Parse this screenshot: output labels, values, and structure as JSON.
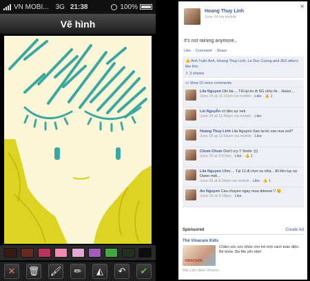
{
  "status": {
    "carrier": "VN MOBI...",
    "network": "3G",
    "time": "21:38",
    "battery": "100%"
  },
  "app": {
    "title": "Vẽ hình"
  },
  "palette": [
    "#3a1a10",
    "#6b2a1e",
    "#b8325a",
    "#f28db2",
    "#e5a6d8",
    "#a15db8",
    "#3fa93c",
    "#23301e",
    "#0d0d0d"
  ],
  "tools": [
    {
      "name": "close-tool",
      "glyph": "✕"
    },
    {
      "name": "trash-tool",
      "glyph": "🗑"
    },
    {
      "name": "brush-tool",
      "glyph": "🖌"
    },
    {
      "name": "pencil-tool",
      "glyph": "✏"
    },
    {
      "name": "eraser-tool",
      "glyph": "◭"
    },
    {
      "name": "undo-tool",
      "glyph": "↶"
    },
    {
      "name": "confirm-tool",
      "glyph": "✔"
    }
  ],
  "colors": {
    "teal": "#3aa8a0",
    "yellow": "#d9cf12",
    "canvas": "#fbf6d8",
    "fb_blue": "#3b5998"
  },
  "post": {
    "author": "Hoang Thuy Linh",
    "time": "June 24 via mobile",
    "text": "It's not raining anymore..",
    "actions": [
      "Like",
      "Comment",
      "Share"
    ],
    "likes": "Anh Tuấn Anh, Hoang Thuy Linh, Le Duc Cuong and 352 others like this.",
    "shares": "3 shares",
    "more_comments": "View 10 more comments"
  },
  "comments": [
    {
      "name": "Lila Nguyen",
      "text": "Oki bà.... Tối lại ko đi SG nữa rồi... Haizz...",
      "time": "June 24 at 11:26pm via mobile",
      "like": "Like",
      "count": "1"
    },
    {
      "name": "Lin Nguyễn",
      "text": "có tâm sự nek",
      "time": "June 24 at 11:46pm via mobile",
      "like": "Like",
      "count": ""
    },
    {
      "name": "Hoang Thuy Linh",
      "text": "Lila Nguyen Sao lại ko vao nua zoii?",
      "time": "June 25 at 12:59am via mobile",
      "like": "Like",
      "count": ""
    },
    {
      "name": "Chum Chum",
      "text": "Don't cry !! Smile :)))",
      "time": "June 25 at 4:57am",
      "like": "Like",
      "count": "1"
    },
    {
      "name": "Lila Nguyen",
      "text": "Uhm.... Tại 11 đi chơi xa nữa... Đi liên tục sợ Owen mệt...",
      "time": "June 25 at 8:24am via mobile",
      "like": "Like",
      "count": "1"
    },
    {
      "name": "An Nguyen",
      "text": "Cau chuyen ngay mua ddeeee !! 😉",
      "time": "June 25 at 3:18pm",
      "like": "Like",
      "count": ""
    }
  ],
  "sponsored": {
    "heading": "Sponsored",
    "create": "Create Ad",
    "title": "Thẻ Vinacare Kids",
    "text": "Chăm sóc sức khỏe cho trẻ một cách toàn diện. Bé khỏe, Ba Mẹ yên tâm!",
    "brand_text": "VINACARE",
    "foot": "Mai Liên likes Vinmec."
  }
}
